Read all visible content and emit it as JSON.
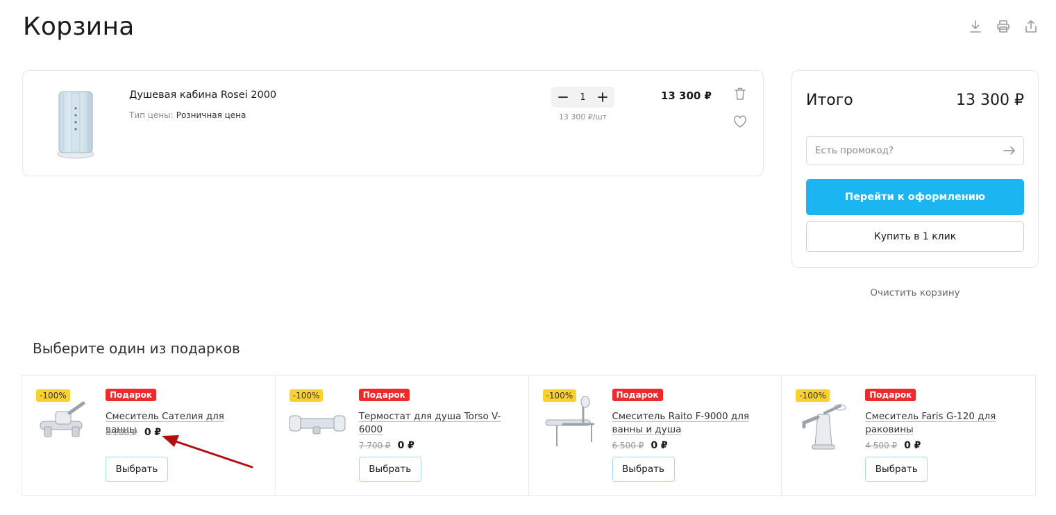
{
  "page": {
    "title": "Корзина"
  },
  "toolbar": {
    "icons": [
      "download-icon",
      "print-icon",
      "share-icon"
    ]
  },
  "cart": {
    "item": {
      "name": "Душевая кабина Rosei 2000",
      "price_type_label": "Тип цены:",
      "price_type_value": "Розничная цена",
      "quantity": "1",
      "unit_price": "13 300 ₽/шт",
      "total": "13 300 ₽"
    }
  },
  "summary": {
    "label": "Итого",
    "total": "13 300 ₽",
    "promo_placeholder": "Есть промокод?",
    "checkout_label": "Перейти к оформлению",
    "one_click_label": "Купить в 1 клик",
    "clear_label": "Очистить корзину"
  },
  "gifts": {
    "title": "Выберите один из подарков",
    "items": [
      {
        "discount": "-100%",
        "badge": "Подарок",
        "name": "Смеситель Сателия для ванны",
        "old_price": "6 200 ₽",
        "new_price": "0 ₽",
        "button": "Выбрать"
      },
      {
        "discount": "-100%",
        "badge": "Подарок",
        "name": "Термостат для душа Torso V-6000",
        "old_price": "7 700 ₽",
        "new_price": "0 ₽",
        "button": "Выбрать"
      },
      {
        "discount": "-100%",
        "badge": "Подарок",
        "name": "Смеситель Raito F-9000 для ванны и душа",
        "old_price": "6 500 ₽",
        "new_price": "0 ₽",
        "button": "Выбрать"
      },
      {
        "discount": "-100%",
        "badge": "Подарок",
        "name": "Смеситель Faris G-120 для раковины",
        "old_price": "4 500 ₽",
        "new_price": "0 ₽",
        "button": "Выбрать"
      }
    ]
  },
  "colors": {
    "accent": "#1bb5f2",
    "badge_red": "#ee2a2a",
    "discount_yellow": "#ffd12e",
    "annotation_arrow": "#b01010"
  }
}
